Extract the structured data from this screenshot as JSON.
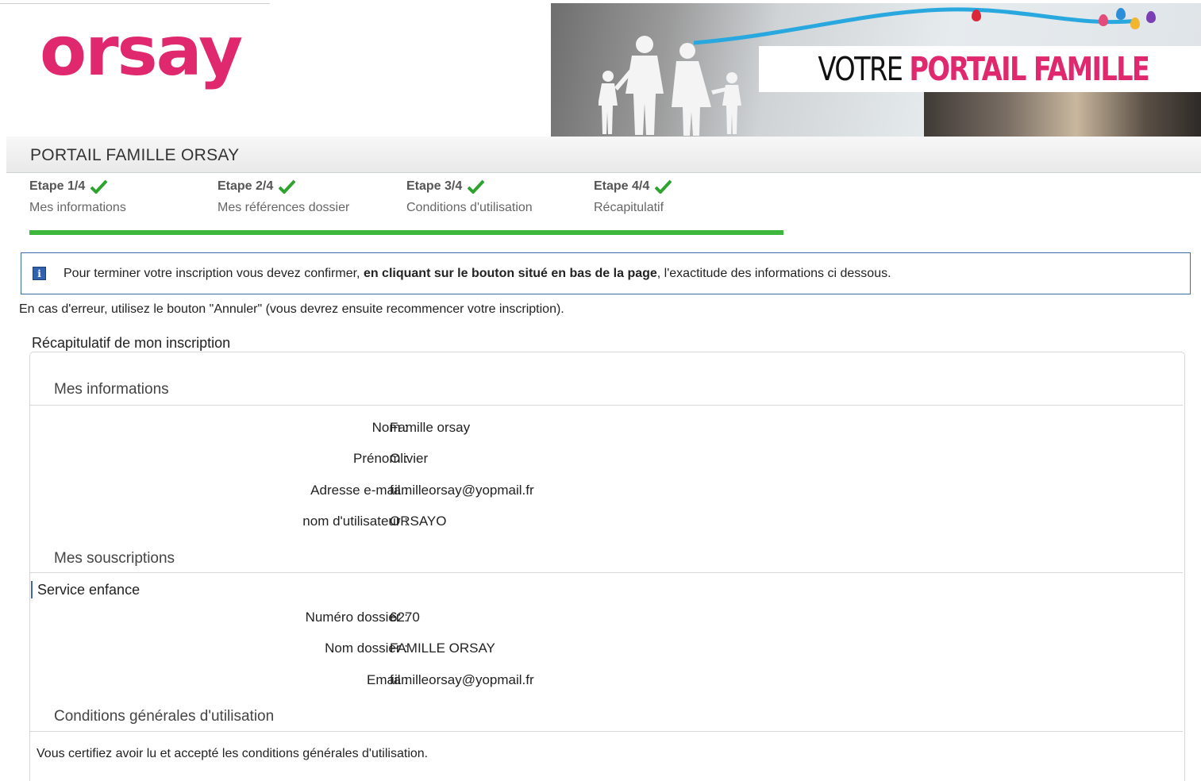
{
  "header": {
    "logo_text": "orsay",
    "banner_title_part1": "VOTRE",
    "banner_title_part2": "PORTAIL FAMILLE"
  },
  "page_title": "PORTAIL FAMILLE ORSAY",
  "steps": [
    {
      "label": "Etape 1/4",
      "sub": "Mes informations"
    },
    {
      "label": "Etape 2/4",
      "sub": "Mes références dossier"
    },
    {
      "label": "Etape 3/4",
      "sub": "Conditions d'utilisation"
    },
    {
      "label": "Etape 4/4",
      "sub": "Récapitulatif"
    }
  ],
  "progress_fraction": 1.0,
  "info": {
    "text_before": "Pour terminer votre inscription vous devez confirmer, ",
    "text_bold": "en cliquant sur le bouton situé en bas de la page",
    "text_after": ", l'exactitude des informations ci dessous."
  },
  "error_note": "En cas d'erreur, utilisez le bouton \"Annuler\" (vous devrez ensuite recommencer votre inscription).",
  "recap": {
    "legend": "Récapitulatif de mon inscription",
    "mes_informations": {
      "title": "Mes informations",
      "rows": [
        {
          "label": "Nom :",
          "value": "Famille orsay"
        },
        {
          "label": "Prénom :",
          "value": "Olivier"
        },
        {
          "label": "Adresse e-mail :",
          "value": "familleorsay@yopmail.fr"
        },
        {
          "label": "nom d'utilisateur :",
          "value": "ORSAYO"
        }
      ]
    },
    "mes_souscriptions": {
      "title": "Mes souscriptions",
      "service_title": "Service enfance",
      "rows": [
        {
          "label": "Numéro dossier :",
          "value": "6270"
        },
        {
          "label": "Nom dossier :",
          "value": "FAMILLE ORSAY"
        },
        {
          "label": "Email :",
          "value": "familleorsay@yopmail.fr"
        }
      ]
    },
    "cgu": {
      "title": "Conditions générales d'utilisation",
      "text": "Vous certifiez avoir lu et accepté les conditions générales d'utilisation."
    }
  },
  "colors": {
    "brand_pink": "#e0286e",
    "progress_green": "#3db83d",
    "info_border": "#3a6aa8"
  }
}
